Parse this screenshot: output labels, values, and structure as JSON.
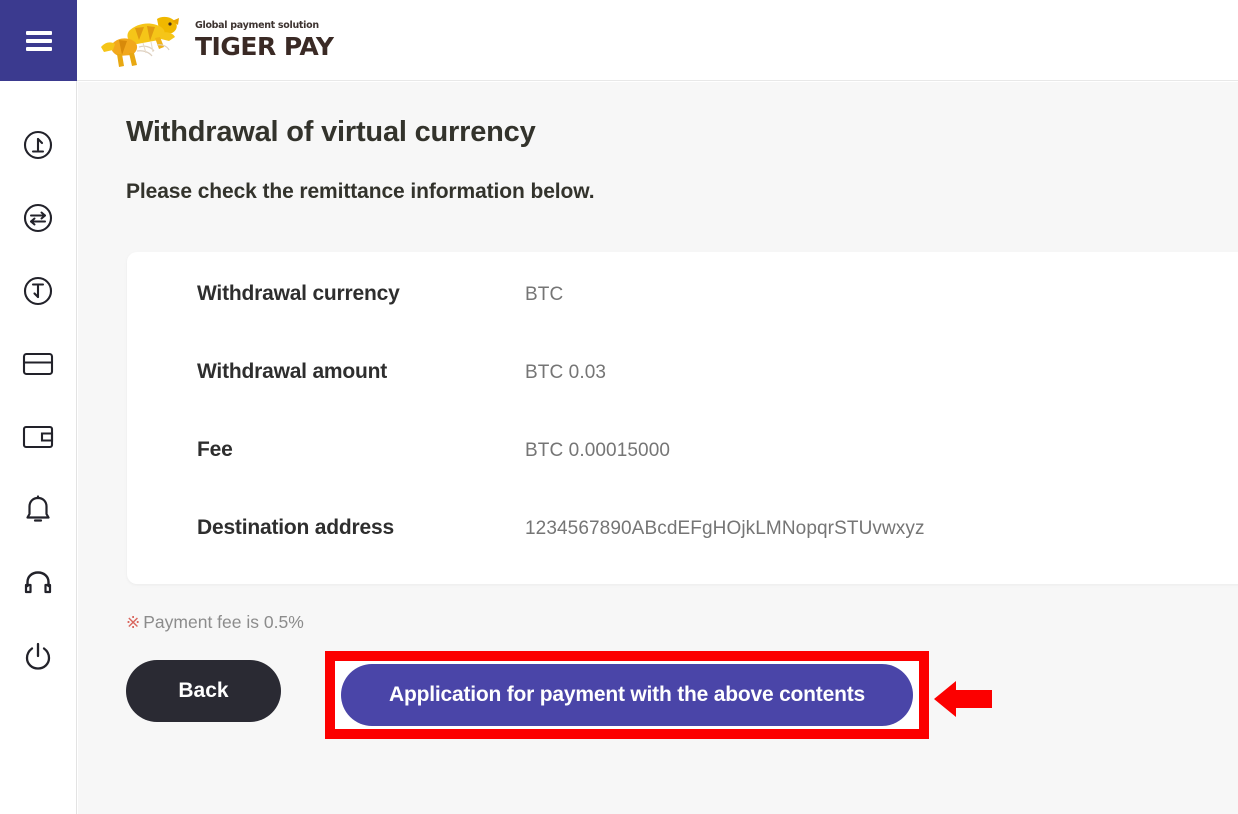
{
  "header": {
    "menu_icon": "hamburger-menu-icon",
    "logo": {
      "tagline": "Global payment solution",
      "name": "TIGER PAY",
      "mark": "tiger-logo-icon"
    }
  },
  "sidebar": {
    "items": [
      {
        "icon": "deposit-arrow-up-circle-icon",
        "name": "deposit"
      },
      {
        "icon": "exchange-arrows-circle-icon",
        "name": "exchange"
      },
      {
        "icon": "withdrawal-arrow-down-circle-icon",
        "name": "withdrawal"
      },
      {
        "icon": "credit-card-icon",
        "name": "card"
      },
      {
        "icon": "wallet-icon",
        "name": "wallet"
      },
      {
        "icon": "bell-icon",
        "name": "notifications"
      },
      {
        "icon": "headset-icon",
        "name": "support"
      },
      {
        "icon": "power-icon",
        "name": "logout"
      }
    ]
  },
  "main": {
    "title": "Withdrawal of virtual currency",
    "subtitle": "Please check the remittance information below.",
    "details": [
      {
        "label": "Withdrawal currency",
        "value": "BTC"
      },
      {
        "label": "Withdrawal amount",
        "value": "BTC 0.03"
      },
      {
        "label": "Fee",
        "value": "BTC 0.00015000"
      },
      {
        "label": "Destination address",
        "value": "1234567890ABcdEFgHOjkLMNopqrSTUvwxyz"
      }
    ],
    "fee_note": {
      "mark": "※",
      "text": "Payment fee is 0.5%"
    },
    "buttons": {
      "back": "Back",
      "submit": "Application for payment with the above contents"
    },
    "annotation": {
      "arrow": "left-pointing-arrow-icon",
      "highlight_color": "#fc0000"
    }
  },
  "colors": {
    "brand_indigo": "#3b3a8f",
    "primary_button": "#4a45a8",
    "back_button": "#2a2a33",
    "annotation_red": "#fc0000",
    "content_bg": "#f7f7f7",
    "label_text": "#2e2e2e",
    "value_text": "#757575"
  }
}
